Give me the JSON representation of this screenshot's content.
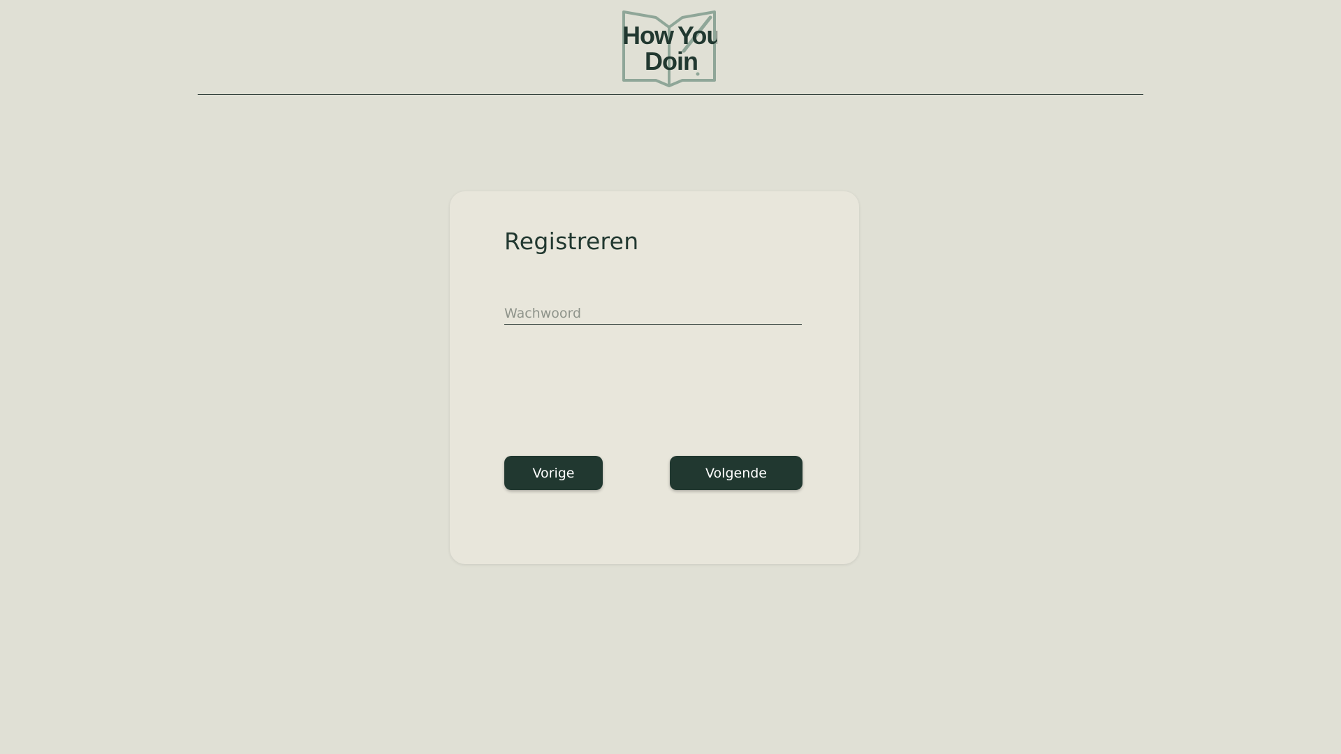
{
  "header": {
    "logo": {
      "line1_left": "How",
      "line1_right": "You",
      "line2": "Doin"
    }
  },
  "register": {
    "title": "Registreren",
    "password": {
      "placeholder": "Wachwoord",
      "value": ""
    },
    "prev_label": "Vorige",
    "next_label": "Volgende"
  },
  "colors": {
    "background": "#e0e0d5",
    "card": "#e8e6db",
    "primary": "#213830",
    "logo_outline": "#8fa698"
  }
}
